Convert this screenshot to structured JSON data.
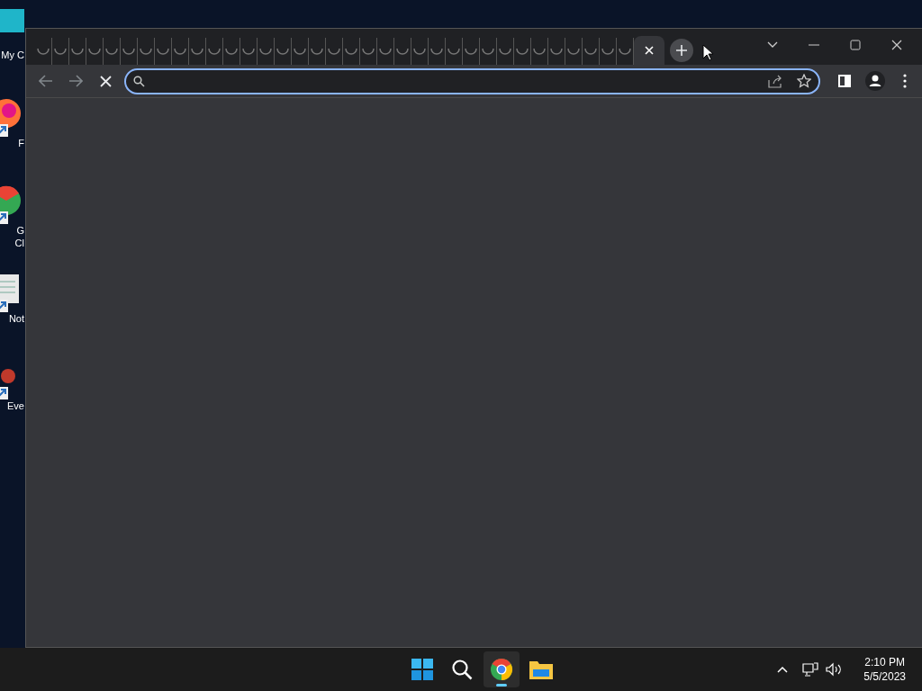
{
  "desktop_icons": [
    {
      "label": "My C",
      "kind": "computer"
    },
    {
      "label": "F",
      "kind": "firefox"
    },
    {
      "label": "G Cl",
      "kind": "chrome"
    },
    {
      "label": "Not",
      "kind": "notepad"
    },
    {
      "label": "Eve",
      "kind": "event"
    }
  ],
  "tabs": [
    {
      "selected": false
    },
    {
      "selected": false
    },
    {
      "selected": false
    },
    {
      "selected": false
    },
    {
      "selected": false
    },
    {
      "selected": false
    },
    {
      "selected": false
    },
    {
      "selected": false
    },
    {
      "selected": false
    },
    {
      "selected": false
    },
    {
      "selected": false
    },
    {
      "selected": false
    },
    {
      "selected": false
    },
    {
      "selected": false
    },
    {
      "selected": false
    },
    {
      "selected": false
    },
    {
      "selected": false
    },
    {
      "selected": false
    },
    {
      "selected": false
    },
    {
      "selected": false
    },
    {
      "selected": false
    },
    {
      "selected": false
    },
    {
      "selected": false
    },
    {
      "selected": false
    },
    {
      "selected": false
    },
    {
      "selected": false
    },
    {
      "selected": false
    },
    {
      "selected": false
    },
    {
      "selected": false
    },
    {
      "selected": false
    },
    {
      "selected": false
    },
    {
      "selected": false
    },
    {
      "selected": false
    },
    {
      "selected": false
    },
    {
      "selected": false
    },
    {
      "selected": true
    }
  ],
  "taskbar": {
    "apps": [
      {
        "kind": "start",
        "selected": false
      },
      {
        "kind": "search",
        "selected": false
      },
      {
        "kind": "chrome",
        "selected": true
      },
      {
        "kind": "files",
        "selected": false
      }
    ],
    "time": "2:10 PM",
    "date": "5/5/2023"
  }
}
